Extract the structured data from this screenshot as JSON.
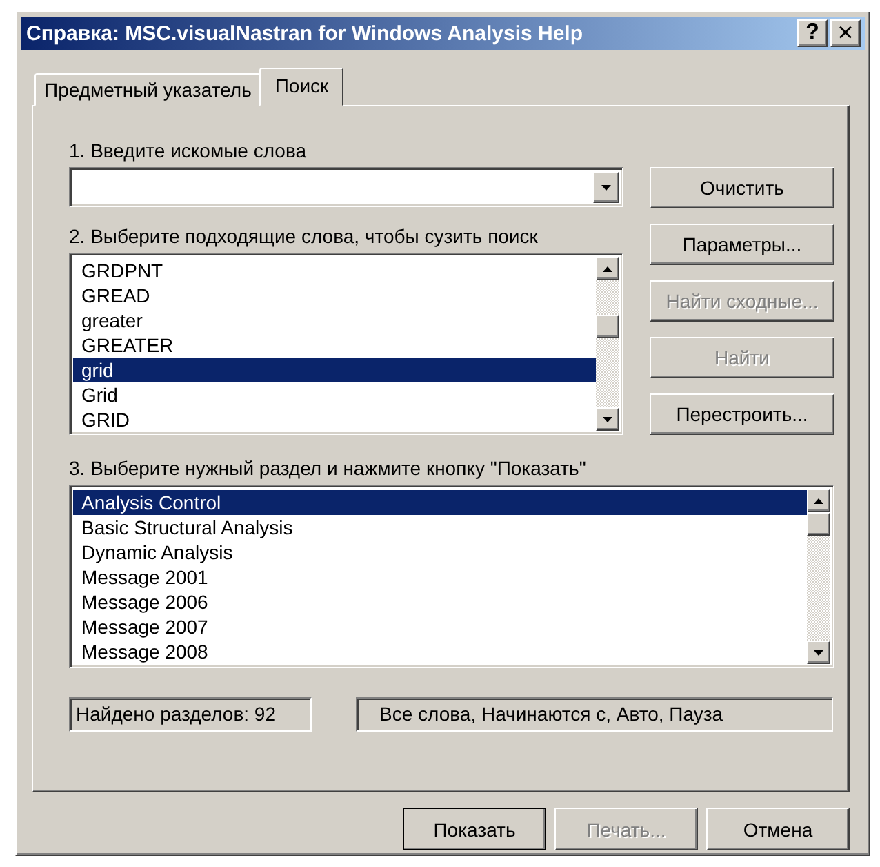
{
  "window": {
    "title": "Справка: MSC.visualNastran for Windows Analysis Help",
    "controls": [
      {
        "kind": "help",
        "label": "?"
      },
      {
        "kind": "close",
        "label": "×"
      }
    ]
  },
  "tabs": [
    {
      "label": "Предметный указатель",
      "selected": false
    },
    {
      "label": "Поиск",
      "selected": true
    }
  ],
  "step1": {
    "label": "1. Введите искомые слова"
  },
  "step2": {
    "label": "2. Выберите подходящие слова, чтобы сузить поиск",
    "items": [
      {
        "text": "GRDPNT",
        "selected": false
      },
      {
        "text": "GREAD",
        "selected": false
      },
      {
        "text": "greater",
        "selected": false
      },
      {
        "text": "GREATER",
        "selected": false
      },
      {
        "text": "grid",
        "selected": true
      },
      {
        "text": "Grid",
        "selected": false
      },
      {
        "text": "GRID",
        "selected": false
      }
    ]
  },
  "side_buttons": [
    {
      "label": "Очистить",
      "disabled": false
    },
    {
      "label": "Параметры...",
      "disabled": false
    },
    {
      "label": "Найти сходные...",
      "disabled": true
    },
    {
      "label": "Найти",
      "disabled": true
    },
    {
      "label": "Перестроить...",
      "disabled": false
    }
  ],
  "step3": {
    "label": "3. Выберите нужный раздел и нажмите кнопку \"Показать\"",
    "items": [
      {
        "text": "Analysis Control",
        "selected": true
      },
      {
        "text": "Basic Structural Analysis",
        "selected": false
      },
      {
        "text": "Dynamic Analysis",
        "selected": false
      },
      {
        "text": "Message 2001",
        "selected": false
      },
      {
        "text": "Message 2006",
        "selected": false
      },
      {
        "text": "Message 2007",
        "selected": false
      },
      {
        "text": "Message 2008",
        "selected": false
      }
    ]
  },
  "status": [
    "Найдено разделов: 92",
    "Все слова, Начинаются с, Авто, Пауза"
  ],
  "footer_buttons": [
    {
      "label": "Показать",
      "disabled": false,
      "default": true
    },
    {
      "label": "Печать...",
      "disabled": true,
      "default": false
    },
    {
      "label": "Отмена",
      "disabled": false,
      "default": false
    }
  ]
}
